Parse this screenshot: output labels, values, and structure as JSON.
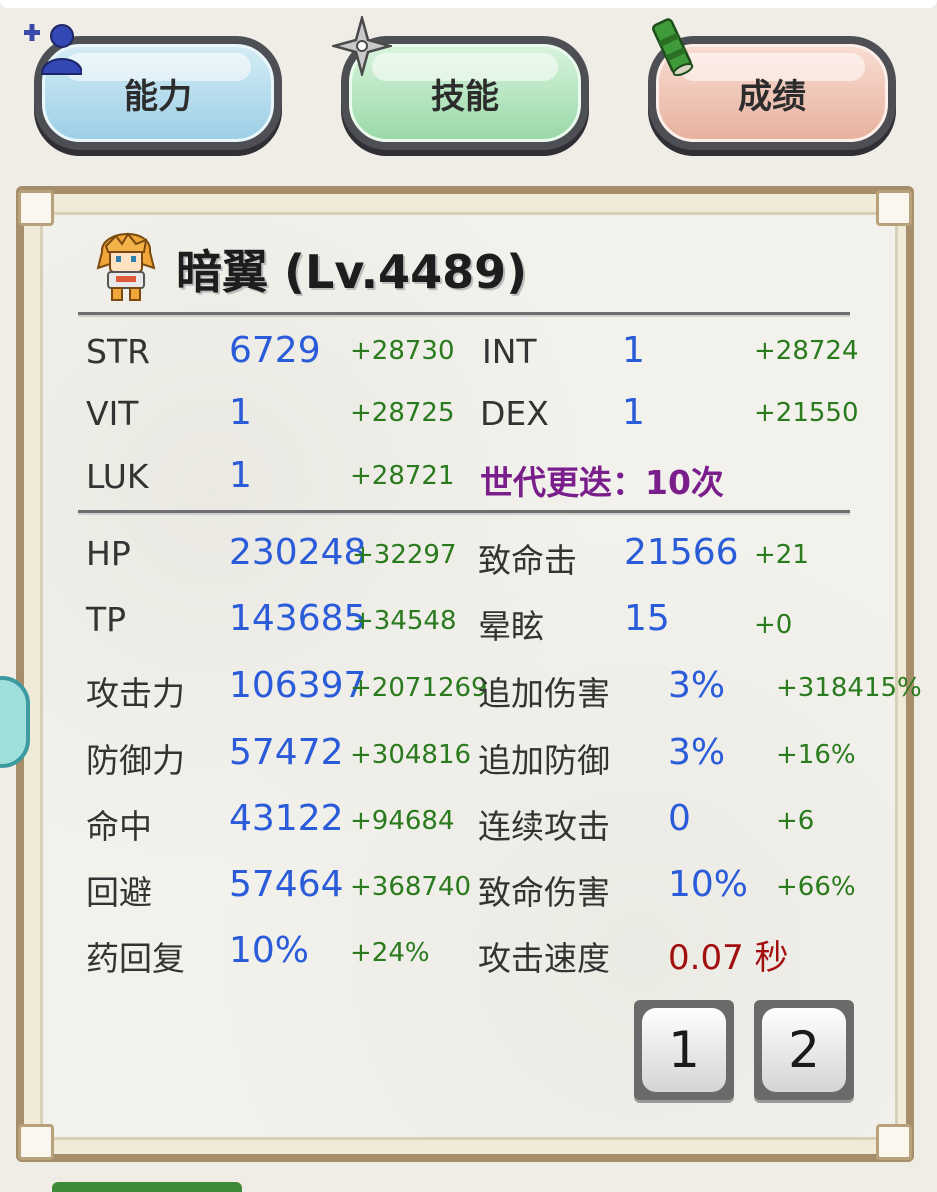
{
  "tabs": [
    {
      "label": "能力",
      "icon": "add-member-icon"
    },
    {
      "label": "技能",
      "icon": "shuriken-icon"
    },
    {
      "label": "成绩",
      "icon": "scroll-icon"
    }
  ],
  "character": {
    "name": "暗翼 (Lv.4489)"
  },
  "base_stats": [
    {
      "label": "STR",
      "value": "6729",
      "bonus": "+28730"
    },
    {
      "label": "INT",
      "value": "1",
      "bonus": "+28724"
    },
    {
      "label": "VIT",
      "value": "1",
      "bonus": "+28725"
    },
    {
      "label": "DEX",
      "value": "1",
      "bonus": "+21550"
    },
    {
      "label": "LUK",
      "value": "1",
      "bonus": "+28721"
    }
  ],
  "generation_text": "世代更迭：10次",
  "combat_stats_left": [
    {
      "label": "HP",
      "value": "230248",
      "bonus": "+32297"
    },
    {
      "label": "TP",
      "value": "143685",
      "bonus": "+34548"
    },
    {
      "label": "攻击力",
      "value": "106397",
      "bonus": "+2071269"
    },
    {
      "label": "防御力",
      "value": "57472",
      "bonus": "+304816"
    },
    {
      "label": "命中",
      "value": "43122",
      "bonus": "+94684"
    },
    {
      "label": "回避",
      "value": "57464",
      "bonus": "+368740"
    },
    {
      "label": "药回复",
      "value": "10%",
      "bonus": "+24%"
    }
  ],
  "combat_stats_right": [
    {
      "label": "致命击",
      "value": "21566",
      "bonus": "+21"
    },
    {
      "label": "晕眩",
      "value": "15",
      "bonus": "+0"
    },
    {
      "label": "追加伤害",
      "value": "3%",
      "bonus": "+318415%"
    },
    {
      "label": "追加防御",
      "value": "3%",
      "bonus": "+16%"
    },
    {
      "label": "连续攻击",
      "value": "0",
      "bonus": "+6"
    },
    {
      "label": "致命伤害",
      "value": "10%",
      "bonus": "+66%"
    },
    {
      "label": "攻击速度",
      "value": "0.07 秒"
    }
  ],
  "pages": [
    "1",
    "2"
  ],
  "colors": {
    "value_blue": "#2a5bd9",
    "bonus_green": "#2a7a1e",
    "generation_purple": "#7a1e8c",
    "speed_red": "#a10f0f"
  }
}
